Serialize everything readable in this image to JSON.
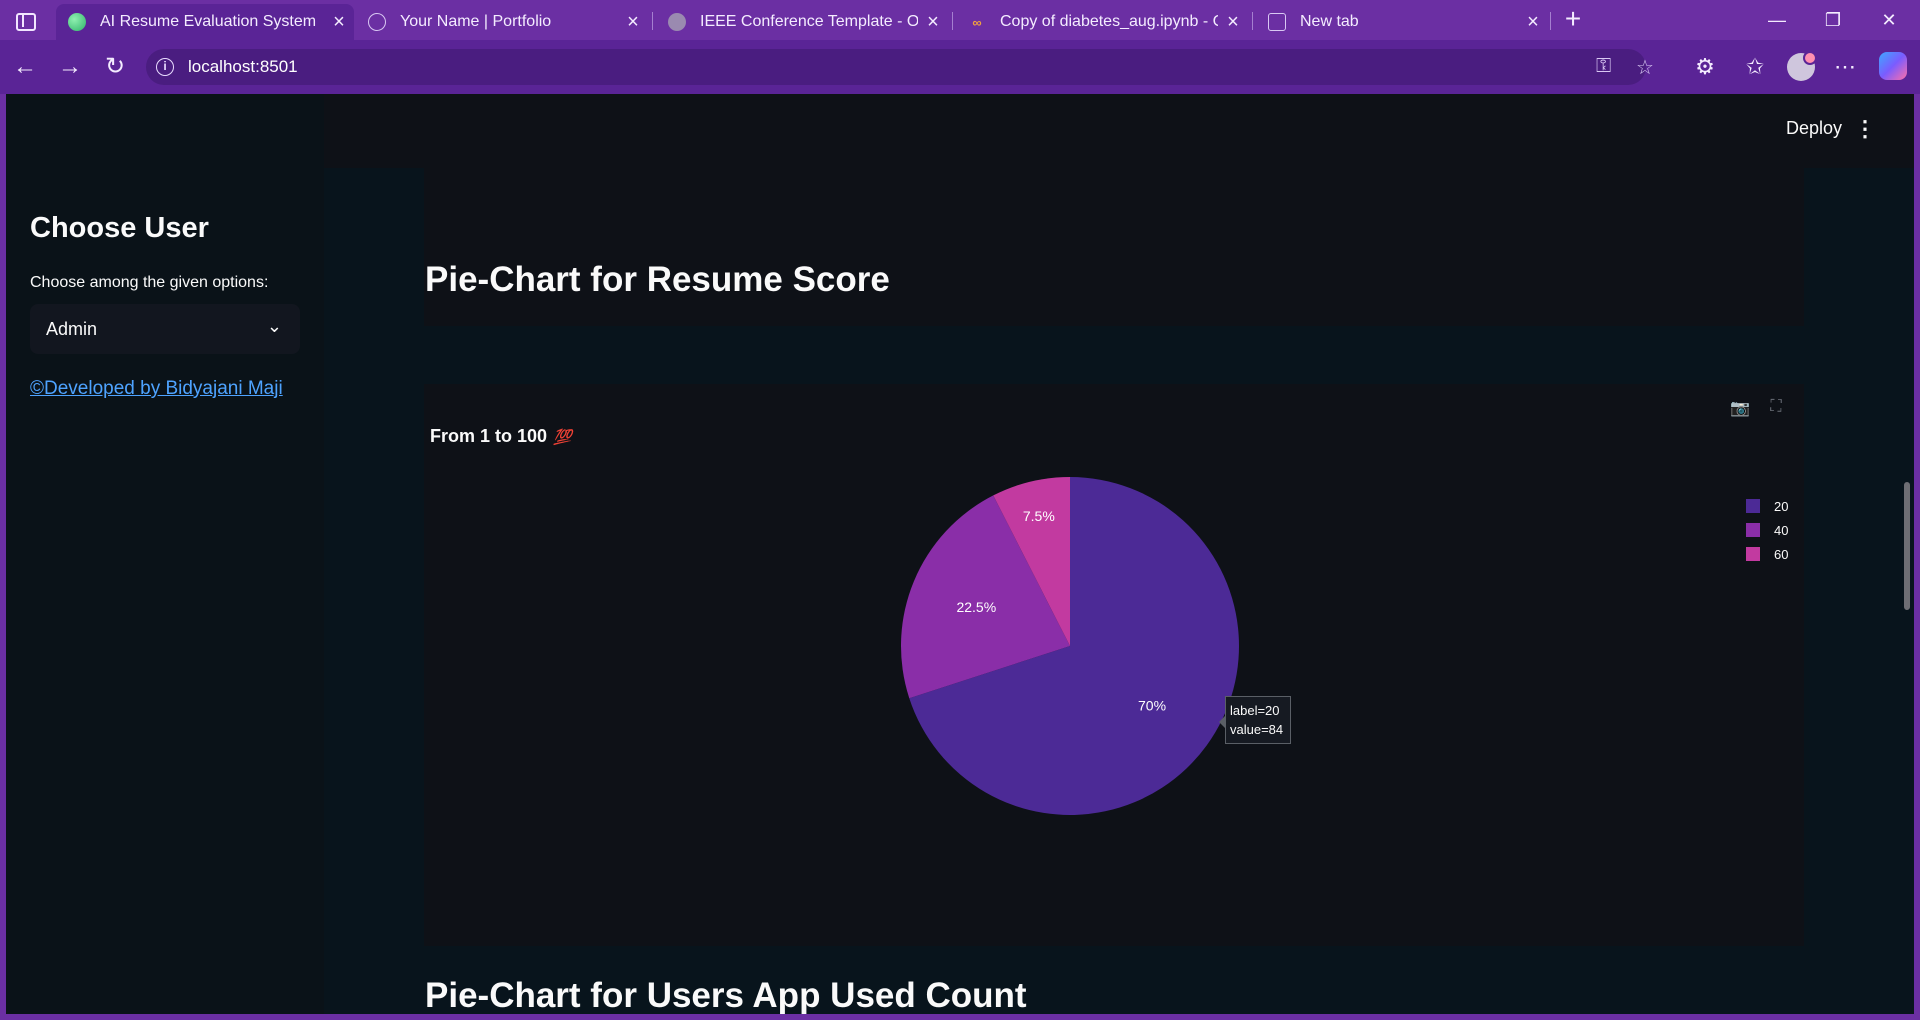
{
  "browser": {
    "tabs": [
      {
        "title": "AI Resume Evaluation System",
        "active": true
      },
      {
        "title": "Your Name | Portfolio",
        "active": false
      },
      {
        "title": "IEEE Conference Template - Online",
        "active": false
      },
      {
        "title": "Copy of diabetes_aug.ipynb - Col",
        "active": false
      },
      {
        "title": "New tab",
        "active": false
      }
    ],
    "url": "localhost:8501"
  },
  "app": {
    "deploy_label": "Deploy",
    "sidebar": {
      "title": "Choose User",
      "select_label": "Choose among the given options:",
      "select_value": "Admin",
      "dev_link": "©Developed by Bidyajani Maji"
    },
    "section1_heading": "Pie-Chart for Resume Score",
    "section2_heading": "Pie-Chart for Users App Used Count",
    "chart": {
      "title": "From 1 to 100",
      "title_emoji": "💯",
      "tooltip": {
        "label_line": "label=20",
        "value_line": "value=84"
      }
    }
  },
  "colors": {
    "accent_blue": "#83c9ff",
    "slice_20": "#4c2a96",
    "slice_40": "#8a2ea8",
    "slice_60": "#c23aa0",
    "link": "#4ea3ff"
  },
  "chart_data": {
    "type": "pie",
    "title": "From 1 to 100",
    "labels": [
      "20",
      "40",
      "60"
    ],
    "values": [
      84,
      27,
      9
    ],
    "percent_labels": [
      "70%",
      "22.5%",
      "7.5%"
    ],
    "legend_position": "top-right"
  }
}
